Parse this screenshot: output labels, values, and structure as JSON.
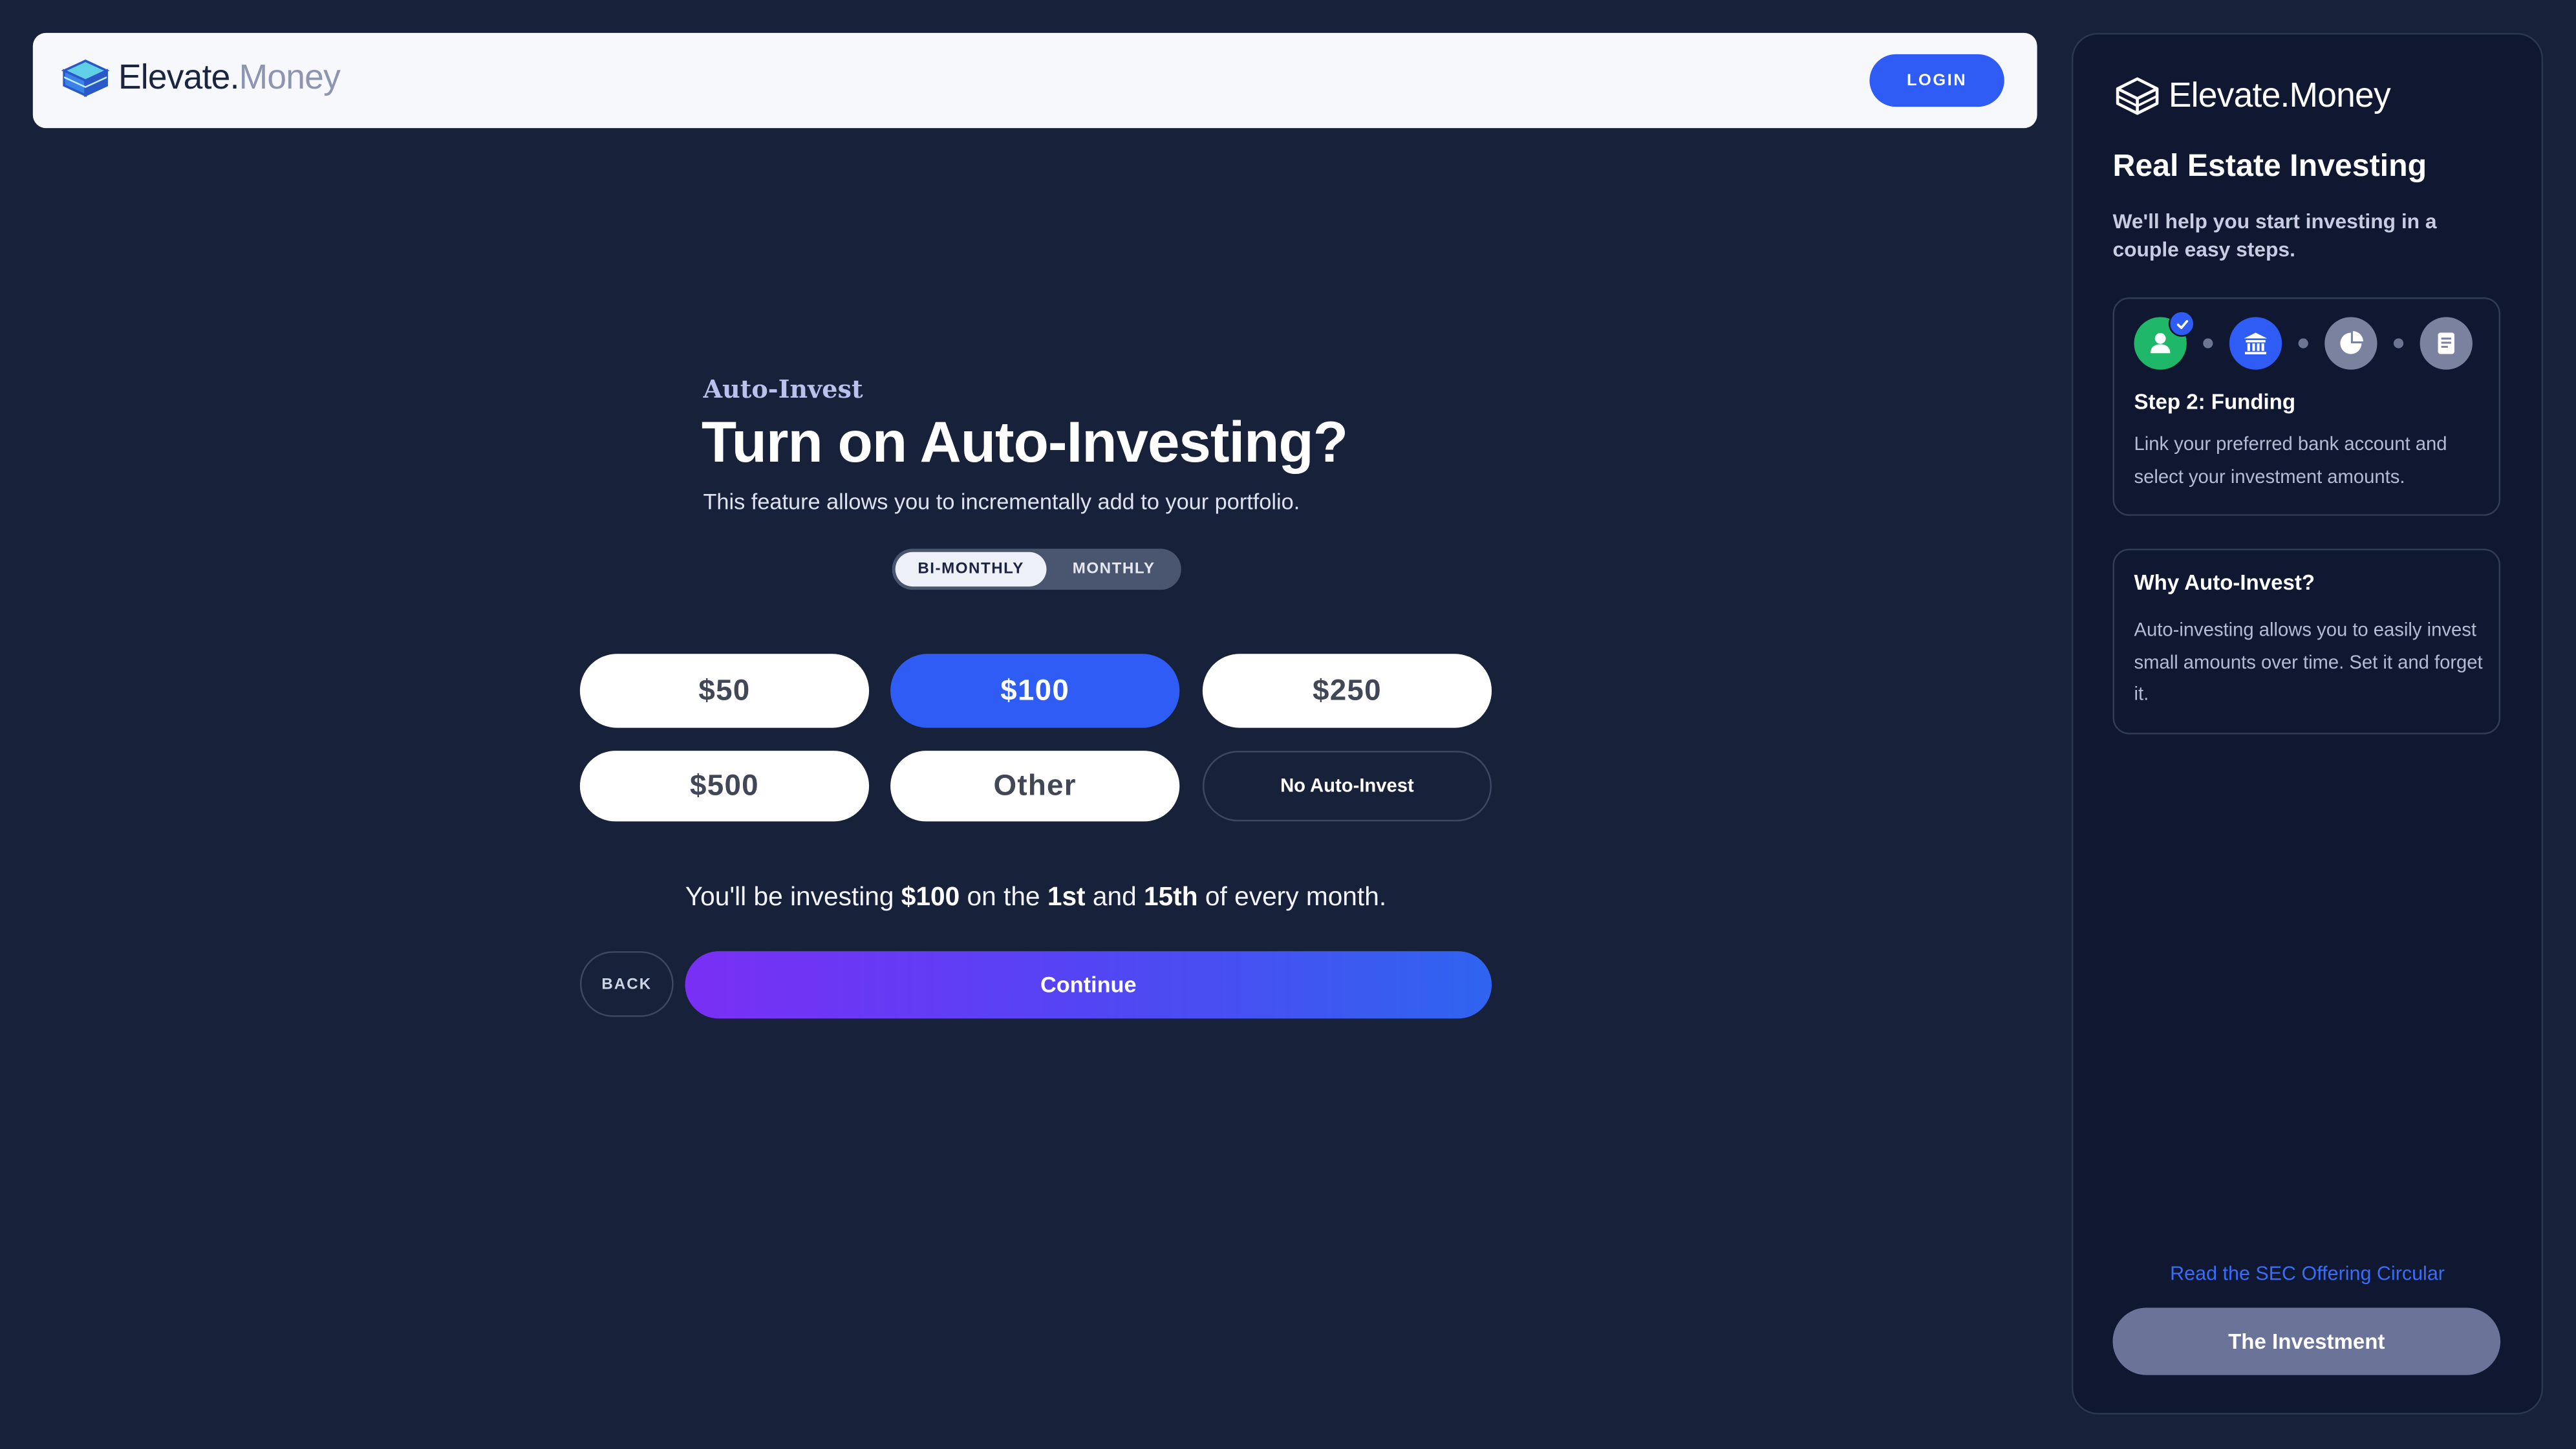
{
  "header": {
    "logo_part1": "Elevate.",
    "logo_part2": "Money",
    "login_label": "LOGIN"
  },
  "main": {
    "eyebrow": "Auto-Invest",
    "title": "Turn on Auto-Investing?",
    "subtitle": "This feature allows you to incrementally add to your portfolio.",
    "frequency_options": [
      "BI-MONTHLY",
      "MONTHLY"
    ],
    "selected_frequency": "BI-MONTHLY",
    "amount_options": [
      "$50",
      "$100",
      "$250",
      "$500",
      "Other",
      "No Auto-Invest"
    ],
    "selected_amount": "$100",
    "summary": {
      "prefix": "You'll be investing ",
      "amount": "$100",
      "mid1": " on the ",
      "day1": "1st",
      "mid2": " and ",
      "day2": "15th",
      "suffix": " of every month."
    },
    "back_label": "BACK",
    "continue_label": "Continue"
  },
  "sidebar": {
    "logo": "Elevate.Money",
    "title": "Real Estate Investing",
    "subtitle": "We'll help you start investing  in a couple easy steps.",
    "steps": [
      {
        "icon": "user-icon",
        "color": "#1fb768",
        "completed": true
      },
      {
        "icon": "bank-icon",
        "color": "#2f5cf4",
        "completed": false
      },
      {
        "icon": "pie-chart-icon",
        "color": "#7b82a0",
        "completed": false
      },
      {
        "icon": "document-icon",
        "color": "#7b82a0",
        "completed": false
      }
    ],
    "step_title": "Step 2: Funding",
    "step_desc": "Link your preferred bank account and select your investment amounts.",
    "why_title": "Why Auto-Invest?",
    "why_desc": "Auto-investing allows you to easily invest small amounts over time. Set it and forget it.",
    "sec_link": "Read the SEC Offering Circular",
    "investment_button": "The Investment"
  },
  "colors": {
    "background": "#17213a",
    "accent": "#2f5cf4",
    "sidebar_bg": "#0f1830",
    "step_done": "#1fb768"
  }
}
